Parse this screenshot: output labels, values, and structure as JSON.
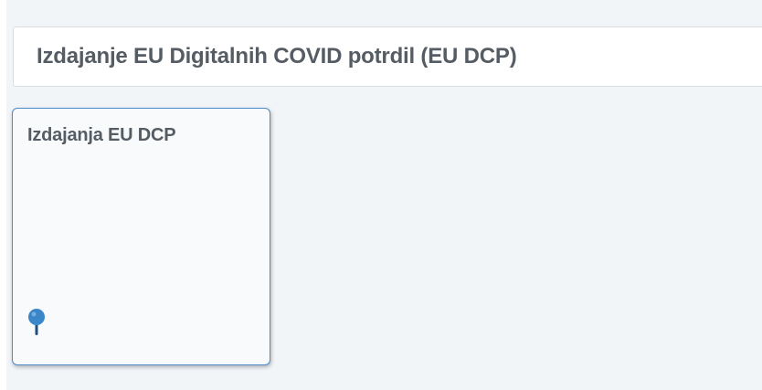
{
  "header": {
    "title": "Izdajanje EU Digitalnih COVID potrdil (EU DCP)"
  },
  "tiles": [
    {
      "title": "Izdajanja EU DCP",
      "icon": "pin-icon"
    }
  ],
  "colors": {
    "background": "#f1f5f8",
    "tile_border": "#4f8cc9",
    "text": "#555c63",
    "pin_head": "#3a86c8",
    "pin_needle": "#1f4f80"
  }
}
